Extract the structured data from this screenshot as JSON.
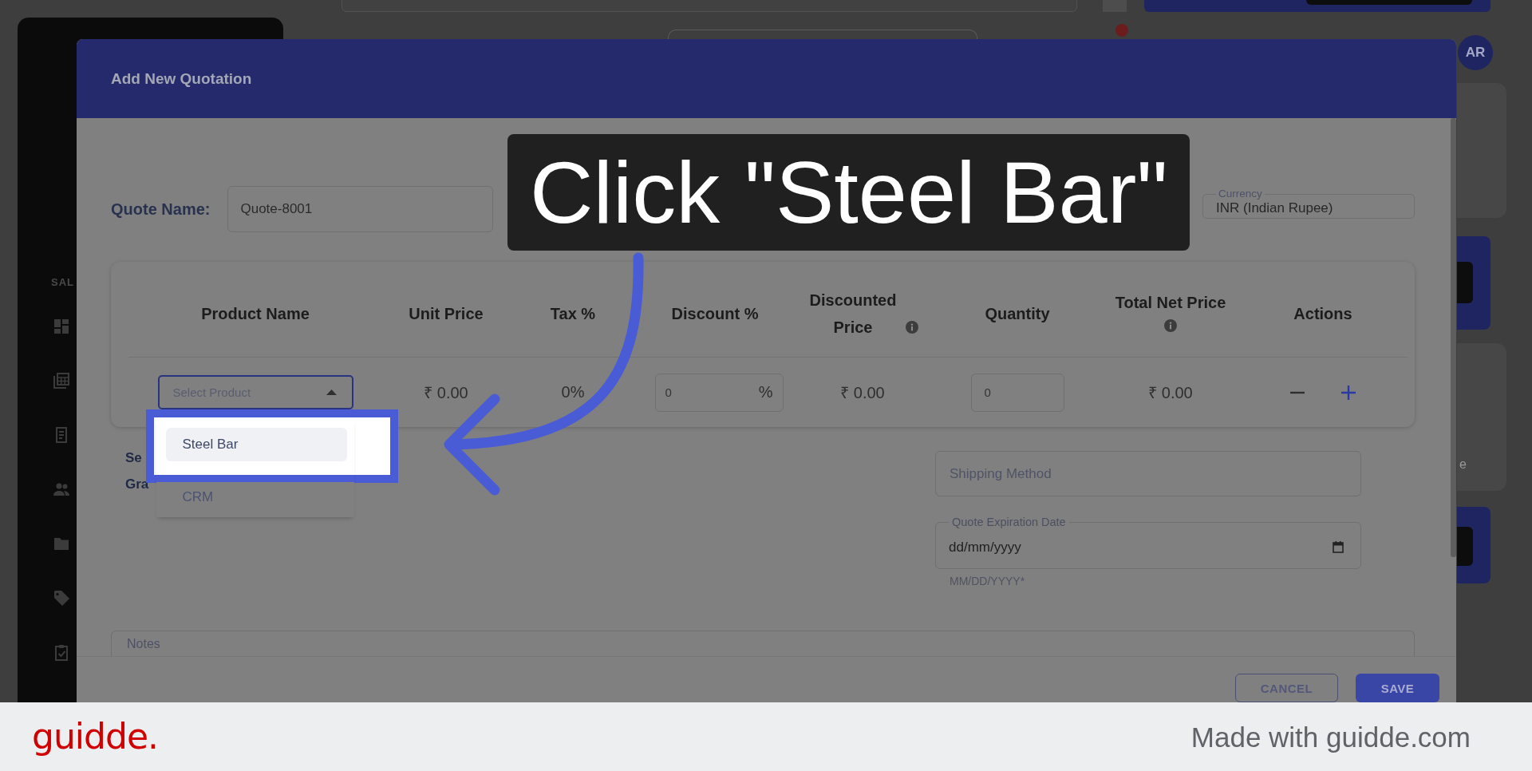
{
  "app_background": {
    "sidebar_section": "SAL",
    "avatar": "AR",
    "card_fragment": "e"
  },
  "dialog": {
    "title": "Add New Quotation",
    "quote_name": {
      "label": "Quote Name:",
      "value": "Quote-8001"
    },
    "currency": {
      "label": "Currency",
      "value": "INR (Indian Rupee)"
    },
    "line_items": {
      "columns": [
        {
          "label": "Product Name",
          "info": false
        },
        {
          "label": "Unit Price",
          "info": false
        },
        {
          "label": "Tax %",
          "info": false
        },
        {
          "label": "Discount %",
          "info": false
        },
        {
          "label": "Discounted Price",
          "info": true
        },
        {
          "label": "Quantity",
          "info": false
        },
        {
          "label": "Total Net Price",
          "info": true
        },
        {
          "label": "Actions",
          "info": false
        }
      ],
      "rows": [
        {
          "product": {
            "placeholder": "Select Product",
            "expanded": true,
            "options": [
              {
                "label": "Steel Bar",
                "selected": true
              },
              {
                "label": "CRM",
                "selected": false
              }
            ]
          },
          "unit_price": "₹ 0.00",
          "tax": "0%",
          "discount": {
            "value": "0",
            "suffix": "%"
          },
          "discounted_price": "₹ 0.00",
          "quantity": {
            "value": "0"
          },
          "total_net_price": "₹ 0.00"
        }
      ]
    },
    "partial_labels": [
      "Se",
      "Gra"
    ],
    "shipping_method": {
      "placeholder": "Shipping Method"
    },
    "expiration_date": {
      "label": "Quote Expiration Date",
      "placeholder": "dd/mm/yyyy",
      "helper": "MM/DD/YYYY*"
    },
    "notes": {
      "placeholder": "Notes"
    },
    "buttons": [
      {
        "label": "CANCEL",
        "kind": "secondary"
      },
      {
        "label": "SAVE",
        "kind": "primary"
      }
    ]
  },
  "annotation": {
    "text": "Click \"Steel Bar\""
  },
  "footer": {
    "logo": "guidde.",
    "credit": "Made with guidde.com"
  }
}
